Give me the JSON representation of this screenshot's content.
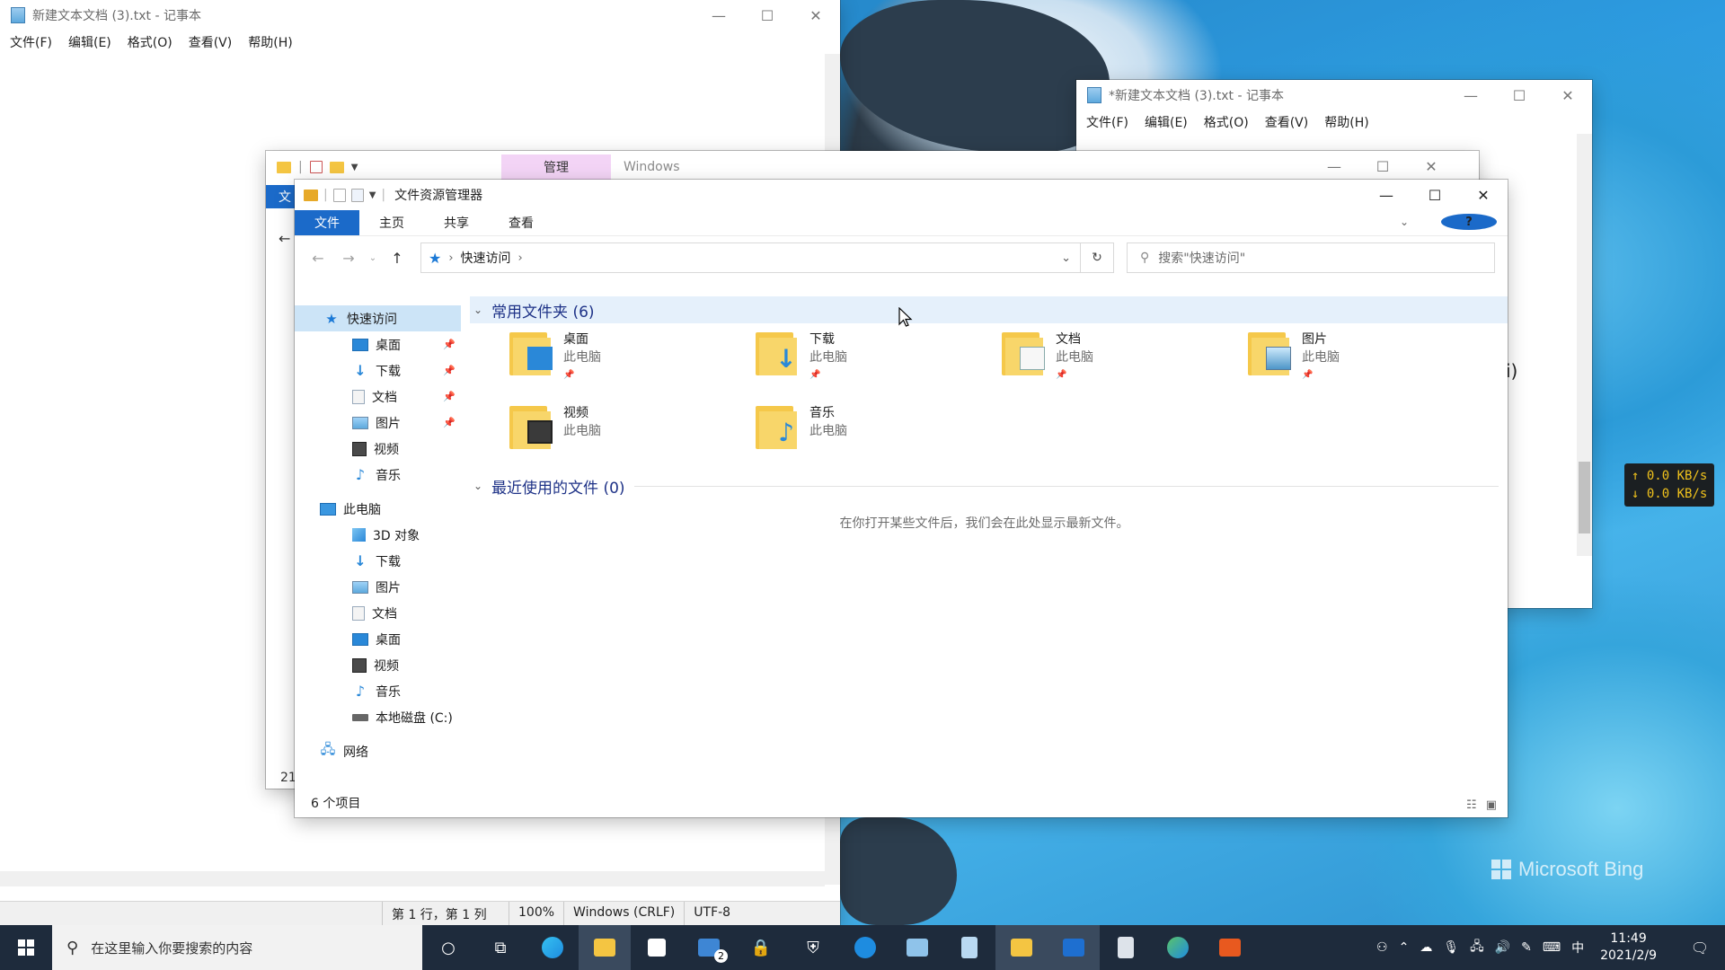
{
  "notepad_back": {
    "title": "新建文本文档 (3).txt - 记事本",
    "menu": [
      "文件(F)",
      "编辑(E)",
      "格式(O)",
      "查看(V)",
      "帮助(H)"
    ],
    "status": {
      "position": "第 1 行，第 1 列",
      "zoom": "100%",
      "line_ending": "Windows (CRLF)",
      "encoding": "UTF-8"
    }
  },
  "notepad_front": {
    "title": "*新建文本文档 (3).txt - 记事本",
    "menu": [
      "文件(F)",
      "编辑(E)",
      "格式(O)",
      "查看(V)",
      "帮助(H)"
    ],
    "partial_text": "i)"
  },
  "explorer_ghost": {
    "manage_tab": "管理",
    "title": "Windows",
    "edge_tab": "文",
    "edge_number": "21"
  },
  "explorer": {
    "title": "文件资源管理器",
    "ribbon_tabs": [
      "文件",
      "主页",
      "共享",
      "查看"
    ],
    "address": {
      "location": "快速访问"
    },
    "search_placeholder": "搜索\"快速访问\"",
    "nav": {
      "quick_access": "快速访问",
      "quick_items": [
        "桌面",
        "下载",
        "文档",
        "图片",
        "视频",
        "音乐"
      ],
      "this_pc": "此电脑",
      "pc_items": [
        "3D 对象",
        "下载",
        "图片",
        "文档",
        "桌面",
        "视频",
        "音乐",
        "本地磁盘 (C:)"
      ],
      "network": "网络"
    },
    "frequent_header": "常用文件夹 (6)",
    "folders": [
      {
        "name": "桌面",
        "location": "此电脑",
        "icon": "desktop-folder-icon"
      },
      {
        "name": "下载",
        "location": "此电脑",
        "icon": "downloads-folder-icon"
      },
      {
        "name": "文档",
        "location": "此电脑",
        "icon": "documents-folder-icon"
      },
      {
        "name": "图片",
        "location": "此电脑",
        "icon": "pictures-folder-icon"
      },
      {
        "name": "视频",
        "location": "此电脑",
        "icon": "videos-folder-icon"
      },
      {
        "name": "音乐",
        "location": "此电脑",
        "icon": "music-folder-icon"
      }
    ],
    "recent_header": "最近使用的文件 (0)",
    "recent_empty": "在你打开某些文件后，我们会在此处显示最新文件。",
    "status": "6 个项目"
  },
  "desktop": {
    "brand": "Microsoft Bing",
    "net_up": "↑ 0.0 KB/s",
    "net_down": "↓ 0.0 KB/s"
  },
  "taskbar": {
    "search_placeholder": "在这里输入你要搜索的内容",
    "mail_badge": "2",
    "input_method": "中",
    "time": "11:49",
    "date": "2021/2/9"
  },
  "colors": {
    "accent": "#1b6ac9",
    "manage_tab": "#f3d4f6",
    "taskbar": "#1e2b3c",
    "group_header_text": "#1e3287"
  }
}
